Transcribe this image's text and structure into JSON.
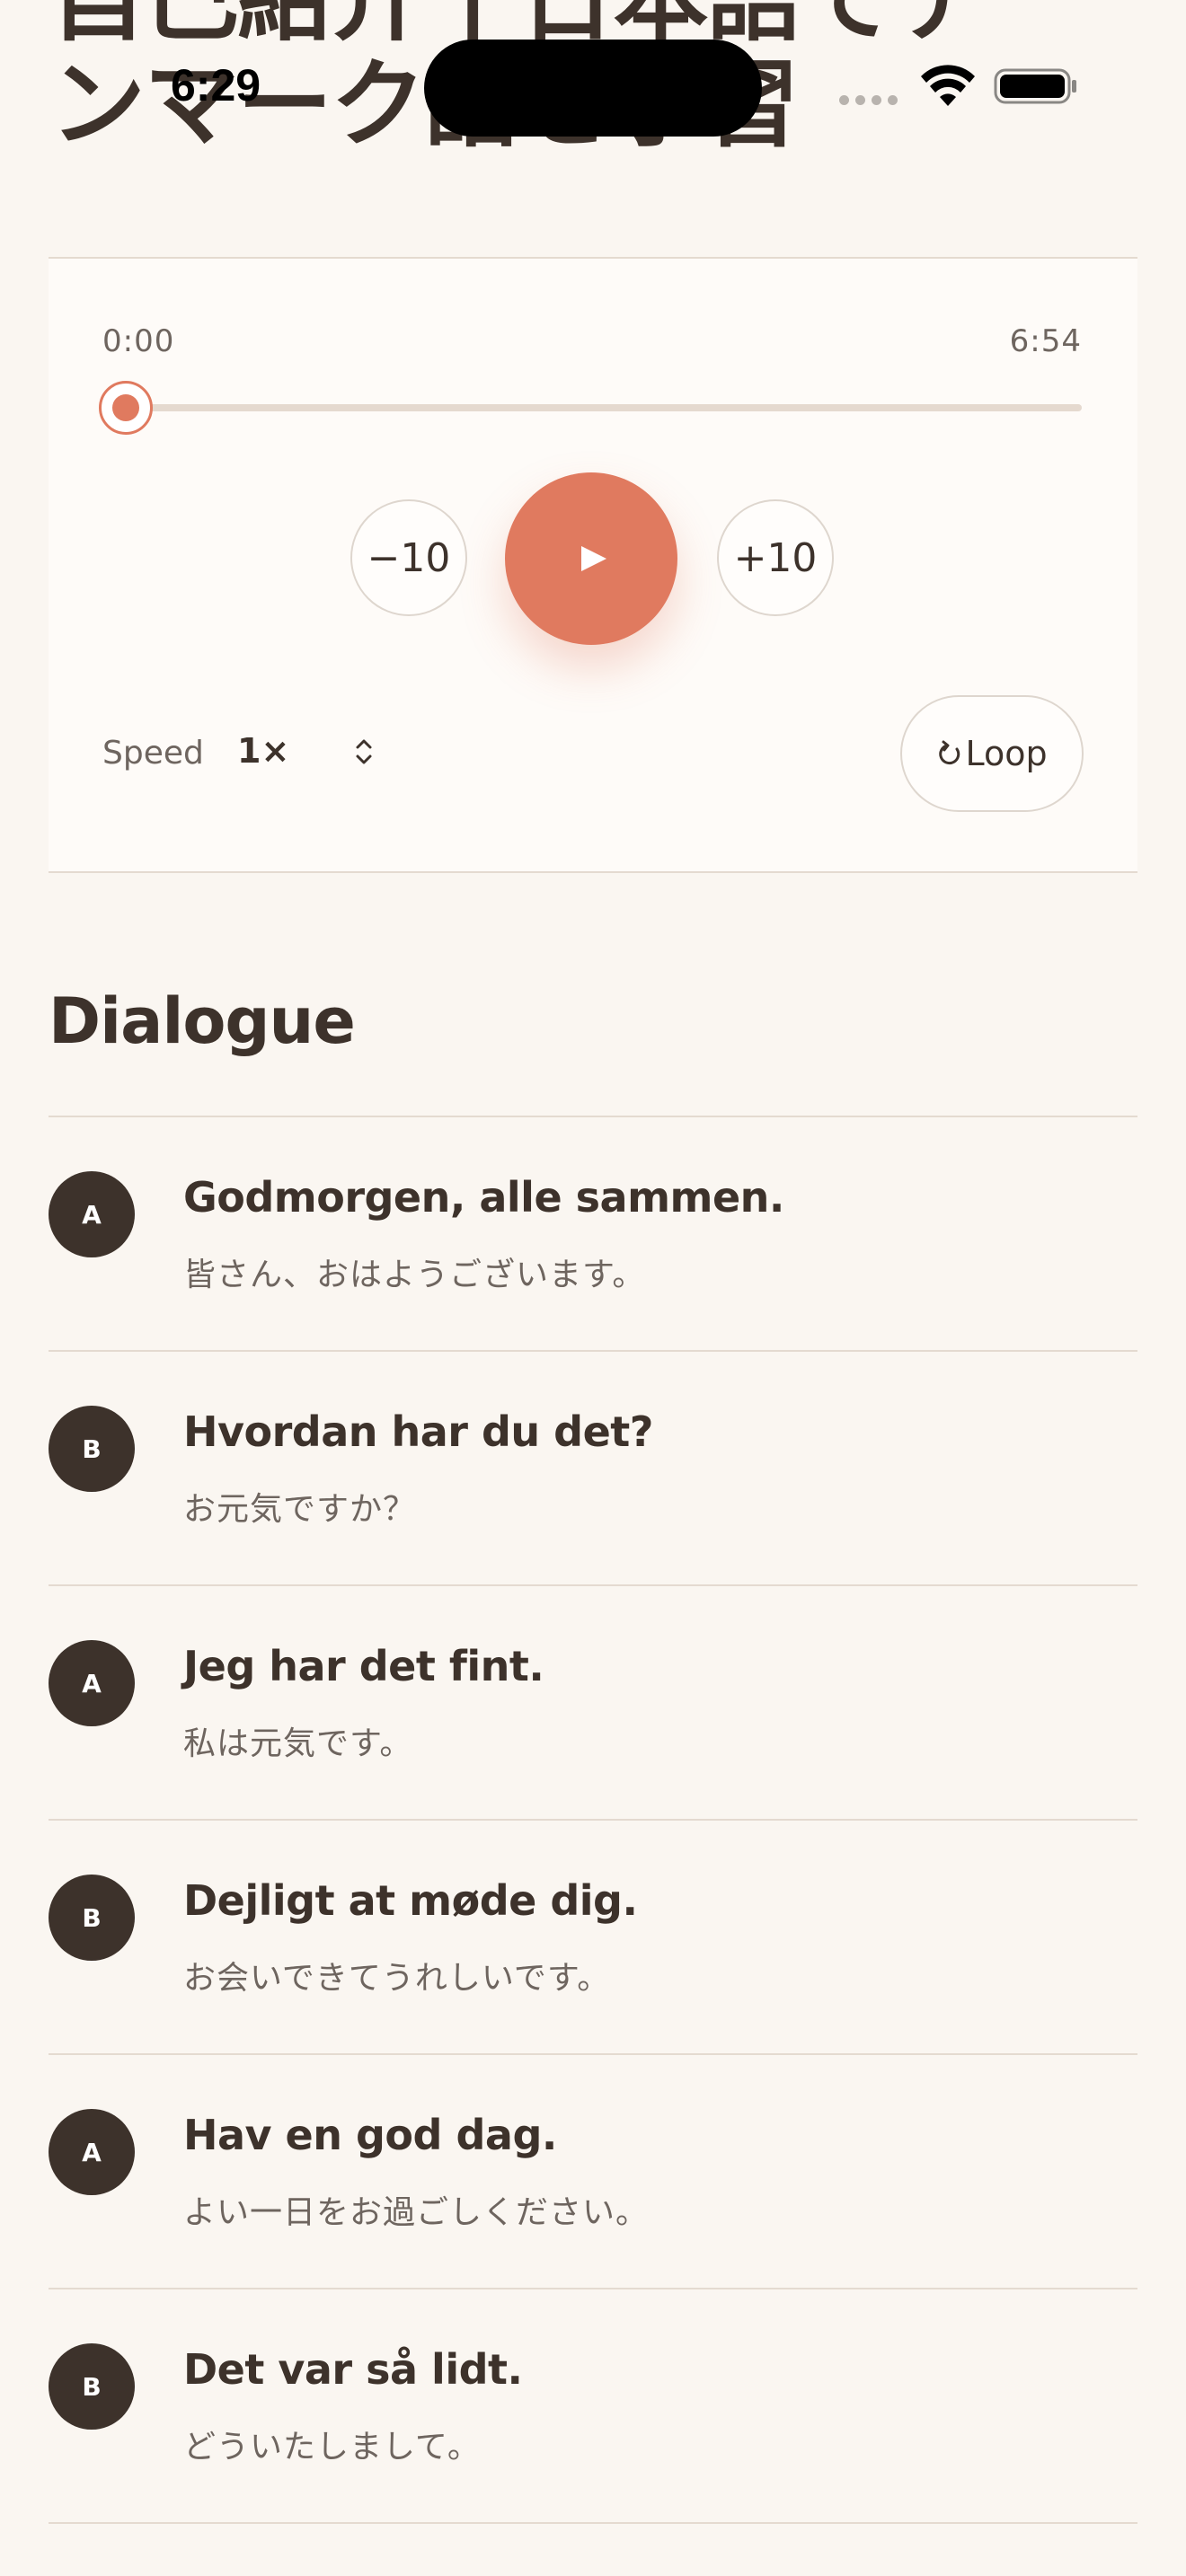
{
  "lesson": {
    "title": "自己紹介 | 日本語でデ\nンマーク語を学習"
  },
  "status_bar": {
    "time": "6:29"
  },
  "player": {
    "current_time": "0:00",
    "duration": "6:54",
    "progress_fraction": 0.0,
    "skip_back_label": "−10",
    "skip_forward_label": "+10",
    "speed_label": "Speed",
    "speed_value": "1×",
    "loop_label": "Loop",
    "accent_color": "#E07A5F"
  },
  "dialogue": {
    "title": "Dialogue",
    "lines": [
      {
        "speaker": "A",
        "text": "Godmorgen, alle sammen.",
        "translation": "皆さん、おはようございます。"
      },
      {
        "speaker": "B",
        "text": "Hvordan har du det?",
        "translation": "お元気ですか？"
      },
      {
        "speaker": "A",
        "text": "Jeg har det fint.",
        "translation": "私は元気です。"
      },
      {
        "speaker": "B",
        "text": "Dejligt at møde dig.",
        "translation": "お会いできてうれしいです。"
      },
      {
        "speaker": "A",
        "text": "Hav en god dag.",
        "translation": "よい一日をお過ごしください。"
      },
      {
        "speaker": "B",
        "text": "Det var så lidt.",
        "translation": "どういたしまして。"
      }
    ]
  },
  "icons": {
    "play": "play-icon",
    "loop": "loop-icon",
    "speed": "chevron-up-down-icon",
    "wifi": "wifi-icon",
    "battery": "battery-icon"
  }
}
